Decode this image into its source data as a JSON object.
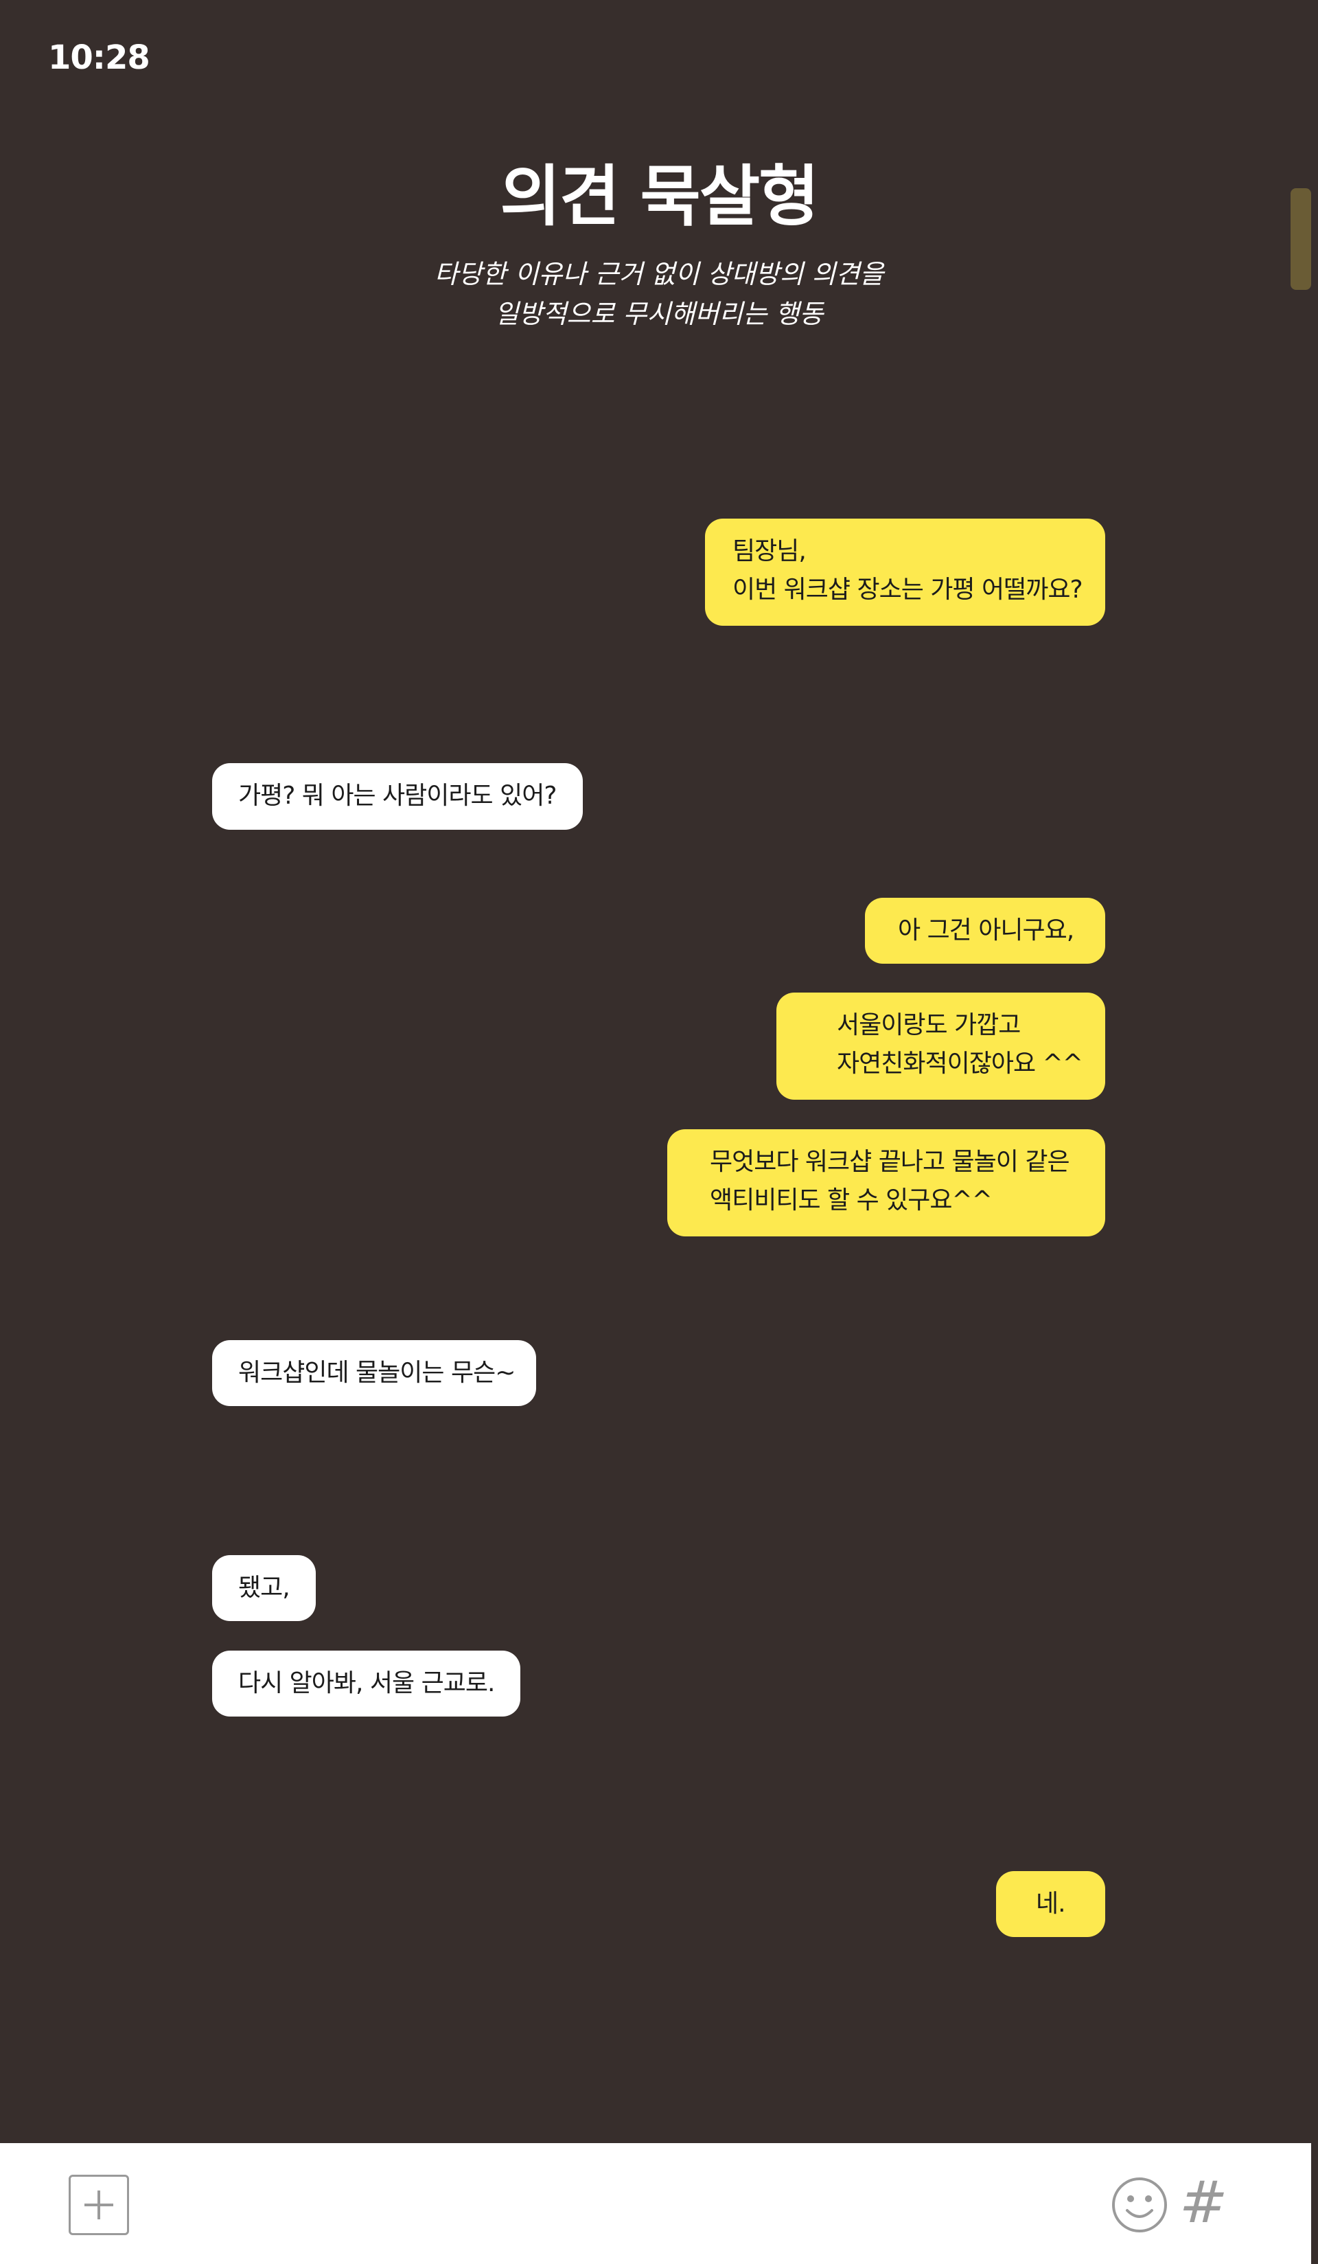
{
  "status_bar": {
    "time": "10:28"
  },
  "header": {
    "title": "의견 묵살형",
    "subtitle_lines": [
      "타당한 이유나 근거 없이 상대방의 의견을",
      "일방적으로 무시해버리는 행동"
    ]
  },
  "messages": [
    {
      "sender": "me",
      "lines": [
        "팀장님,",
        "이번 워크샵 장소는 가평 어떨까요?"
      ]
    },
    {
      "sender": "other",
      "lines": [
        "가평? 뭐 아는 사람이라도 있어?"
      ]
    },
    {
      "sender": "me",
      "lines": [
        "아 그건 아니구요,"
      ]
    },
    {
      "sender": "me",
      "lines": [
        "서울이랑도 가깝고",
        "자연친화적이잖아요 ^^"
      ]
    },
    {
      "sender": "me",
      "lines": [
        "무엇보다 워크샵 끝나고 물놀이 같은",
        "액티비티도 할 수 있구요^^"
      ]
    },
    {
      "sender": "other",
      "lines": [
        "워크샵인데 물놀이는 무슨~"
      ]
    },
    {
      "sender": "other",
      "lines": [
        "됐고,"
      ]
    },
    {
      "sender": "other",
      "lines": [
        "다시 알아봐, 서울 근교로."
      ]
    },
    {
      "sender": "me",
      "lines": [
        "네."
      ]
    }
  ],
  "input_bar": {
    "icons": [
      "plus-icon",
      "emoji-icon",
      "hash-icon"
    ],
    "hash_symbol": "#"
  },
  "colors": {
    "background": "#372e2c",
    "my_bubble": "#fde94f",
    "other_bubble": "#ffffff",
    "icon_gray": "#9a9a9a"
  }
}
